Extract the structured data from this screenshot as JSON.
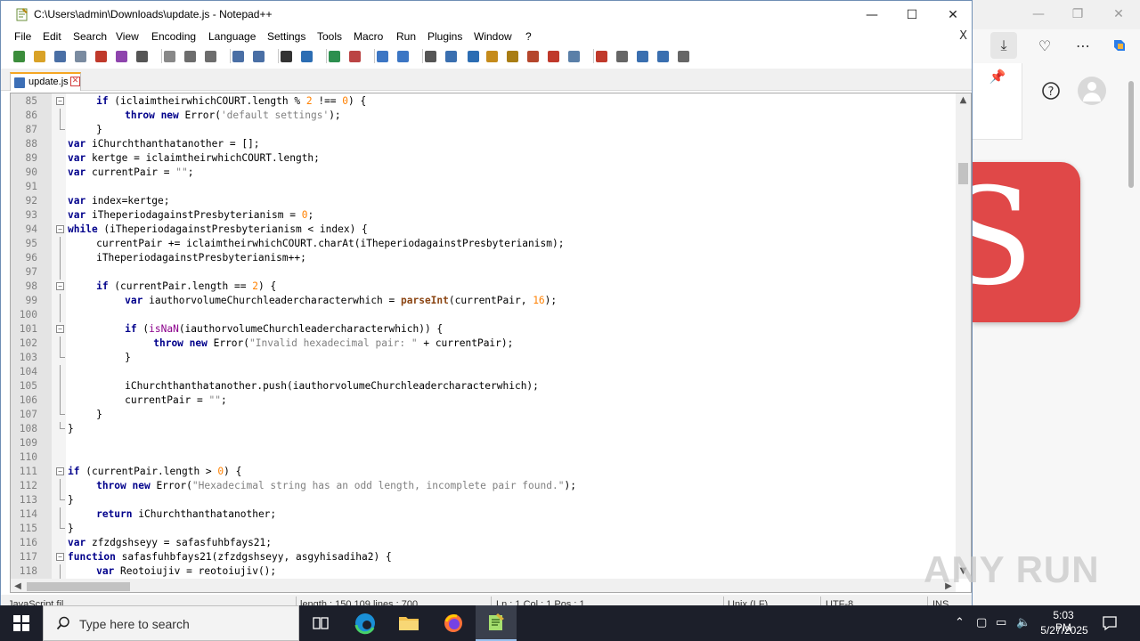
{
  "window": {
    "title": "C:\\Users\\admin\\Downloads\\update.js - Notepad++",
    "minimize": "—",
    "maximize": "☐",
    "close": "✕"
  },
  "menu": [
    "File",
    "Edit",
    "Search",
    "View",
    "Encoding",
    "Language",
    "Settings",
    "Tools",
    "Macro",
    "Run",
    "Plugins",
    "Window",
    "?"
  ],
  "menu_close": "X",
  "tab": {
    "label": "update.js"
  },
  "editor": {
    "lines": [
      {
        "n": "85",
        "fold": "box",
        "ind": 4,
        "code": [
          [
            "k",
            "if"
          ],
          [
            "t",
            " (iclaimtheirwhichCOURT.length % "
          ],
          [
            "n",
            "2"
          ],
          [
            "t",
            " !== "
          ],
          [
            "n",
            "0"
          ],
          [
            "t",
            ") {"
          ]
        ]
      },
      {
        "n": "86",
        "fold": "line",
        "ind": 8,
        "code": [
          [
            "k",
            "throw new"
          ],
          [
            "t",
            " Error("
          ],
          [
            "s",
            "'default settings'"
          ],
          [
            "t",
            ");"
          ]
        ]
      },
      {
        "n": "87",
        "fold": "end",
        "ind": 4,
        "code": [
          [
            "t",
            "}"
          ]
        ]
      },
      {
        "n": "88",
        "fold": "",
        "ind": 0,
        "code": [
          [
            "k",
            "var"
          ],
          [
            "t",
            " iChurchthanthatanother = [];"
          ]
        ]
      },
      {
        "n": "89",
        "fold": "",
        "ind": 0,
        "code": [
          [
            "k",
            "var"
          ],
          [
            "t",
            " kertge = iclaimtheirwhichCOURT.length;"
          ]
        ]
      },
      {
        "n": "90",
        "fold": "",
        "ind": 0,
        "code": [
          [
            "k",
            "var"
          ],
          [
            "t",
            " currentPair = "
          ],
          [
            "s",
            "\"\""
          ],
          [
            "t",
            ";"
          ]
        ]
      },
      {
        "n": "91",
        "fold": "",
        "ind": 0,
        "code": []
      },
      {
        "n": "92",
        "fold": "",
        "ind": 0,
        "code": [
          [
            "k",
            "var"
          ],
          [
            "t",
            " index=kertge;"
          ]
        ]
      },
      {
        "n": "93",
        "fold": "",
        "ind": 0,
        "code": [
          [
            "k",
            "var"
          ],
          [
            "t",
            " iTheperiodagainstPresbyterianism = "
          ],
          [
            "n",
            "0"
          ],
          [
            "t",
            ";"
          ]
        ]
      },
      {
        "n": "94",
        "fold": "box",
        "ind": 0,
        "code": [
          [
            "k",
            "while"
          ],
          [
            "t",
            " (iTheperiodagainstPresbyterianism < index) {"
          ]
        ]
      },
      {
        "n": "95",
        "fold": "line",
        "ind": 4,
        "code": [
          [
            "t",
            "currentPair += iclaimtheirwhichCOURT.charAt(iTheperiodagainstPresbyterianism);"
          ]
        ]
      },
      {
        "n": "96",
        "fold": "line",
        "ind": 4,
        "code": [
          [
            "t",
            "iTheperiodagainstPresbyterianism++;"
          ]
        ]
      },
      {
        "n": "97",
        "fold": "line",
        "ind": 0,
        "code": []
      },
      {
        "n": "98",
        "fold": "box",
        "ind": 4,
        "code": [
          [
            "k",
            "if"
          ],
          [
            "t",
            " (currentPair.length == "
          ],
          [
            "n",
            "2"
          ],
          [
            "t",
            ") {"
          ]
        ]
      },
      {
        "n": "99",
        "fold": "line",
        "ind": 8,
        "code": [
          [
            "k",
            "var"
          ],
          [
            "t",
            " iauthorvolumeChurchleadercharacterwhich = "
          ],
          [
            "f",
            "parseInt"
          ],
          [
            "t",
            "(currentPair, "
          ],
          [
            "n",
            "16"
          ],
          [
            "t",
            ");"
          ]
        ]
      },
      {
        "n": "100",
        "fold": "line",
        "ind": 0,
        "code": []
      },
      {
        "n": "101",
        "fold": "box",
        "ind": 8,
        "code": [
          [
            "k",
            "if"
          ],
          [
            "t",
            " ("
          ],
          [
            "k2",
            "isNaN"
          ],
          [
            "t",
            "(iauthorvolumeChurchleadercharacterwhich)) {"
          ]
        ]
      },
      {
        "n": "102",
        "fold": "line",
        "ind": 12,
        "code": [
          [
            "k",
            "throw new"
          ],
          [
            "t",
            " Error("
          ],
          [
            "s",
            "\"Invalid hexadecimal pair: \""
          ],
          [
            "t",
            " + currentPair);"
          ]
        ]
      },
      {
        "n": "103",
        "fold": "end",
        "ind": 8,
        "code": [
          [
            "t",
            "}"
          ]
        ]
      },
      {
        "n": "104",
        "fold": "line",
        "ind": 0,
        "code": []
      },
      {
        "n": "105",
        "fold": "line",
        "ind": 8,
        "code": [
          [
            "t",
            "iChurchthanthatanother.push(iauthorvolumeChurchleadercharacterwhich);"
          ]
        ]
      },
      {
        "n": "106",
        "fold": "line",
        "ind": 8,
        "code": [
          [
            "t",
            "currentPair = "
          ],
          [
            "s",
            "\"\""
          ],
          [
            "t",
            ";"
          ]
        ]
      },
      {
        "n": "107",
        "fold": "end",
        "ind": 4,
        "code": [
          [
            "t",
            "}"
          ]
        ]
      },
      {
        "n": "108",
        "fold": "end",
        "ind": 0,
        "code": [
          [
            "t",
            "}"
          ]
        ]
      },
      {
        "n": "109",
        "fold": "",
        "ind": 0,
        "code": []
      },
      {
        "n": "110",
        "fold": "",
        "ind": 0,
        "code": []
      },
      {
        "n": "111",
        "fold": "box",
        "ind": 0,
        "code": [
          [
            "k",
            "if"
          ],
          [
            "t",
            " (currentPair.length > "
          ],
          [
            "n",
            "0"
          ],
          [
            "t",
            ") {"
          ]
        ]
      },
      {
        "n": "112",
        "fold": "line",
        "ind": 4,
        "code": [
          [
            "k",
            "throw new"
          ],
          [
            "t",
            " Error("
          ],
          [
            "s",
            "\"Hexadecimal string has an odd length, incomplete pair found.\""
          ],
          [
            "t",
            ");"
          ]
        ]
      },
      {
        "n": "113",
        "fold": "end",
        "ind": 0,
        "code": [
          [
            "t",
            "}"
          ]
        ]
      },
      {
        "n": "114",
        "fold": "line",
        "ind": 4,
        "code": [
          [
            "k",
            "return"
          ],
          [
            "t",
            " iChurchthanthatanother;"
          ]
        ]
      },
      {
        "n": "115",
        "fold": "end",
        "ind": 0,
        "code": [
          [
            "t",
            "}"
          ]
        ]
      },
      {
        "n": "116",
        "fold": "",
        "ind": 0,
        "code": [
          [
            "k",
            "var"
          ],
          [
            "t",
            " zfzdgshseyy = safasfuhbfays21;"
          ]
        ]
      },
      {
        "n": "117",
        "fold": "box",
        "ind": 0,
        "code": [
          [
            "k",
            "function"
          ],
          [
            "t",
            " safasfuhbfays21(zfzdgshseyy, asgyhisadiha2) {"
          ]
        ]
      },
      {
        "n": "118",
        "fold": "line",
        "ind": 4,
        "code": [
          [
            "k",
            "var"
          ],
          [
            "t",
            " Reotoiujiv = reotoiujiv();"
          ]
        ]
      }
    ]
  },
  "statusbar": {
    "type": "JavaScript fil",
    "length": "length : 150,109    lines : 700",
    "position": "Ln : 1    Col : 1    Pos : 1",
    "eol": "Unix (LF)",
    "encoding": "UTF-8",
    "mode": "INS"
  },
  "watermark": "ANY RUN",
  "taskbar": {
    "search_placeholder": "Type here to search",
    "time": "5:03 PM",
    "date": "5/27/2025"
  },
  "colors": {
    "keyword": "#00008b",
    "string": "#808080",
    "number": "#ff8000",
    "builtin": "#8b4513",
    "tab_accent": "#f5a623",
    "taskbar": "#1c1f2a"
  }
}
